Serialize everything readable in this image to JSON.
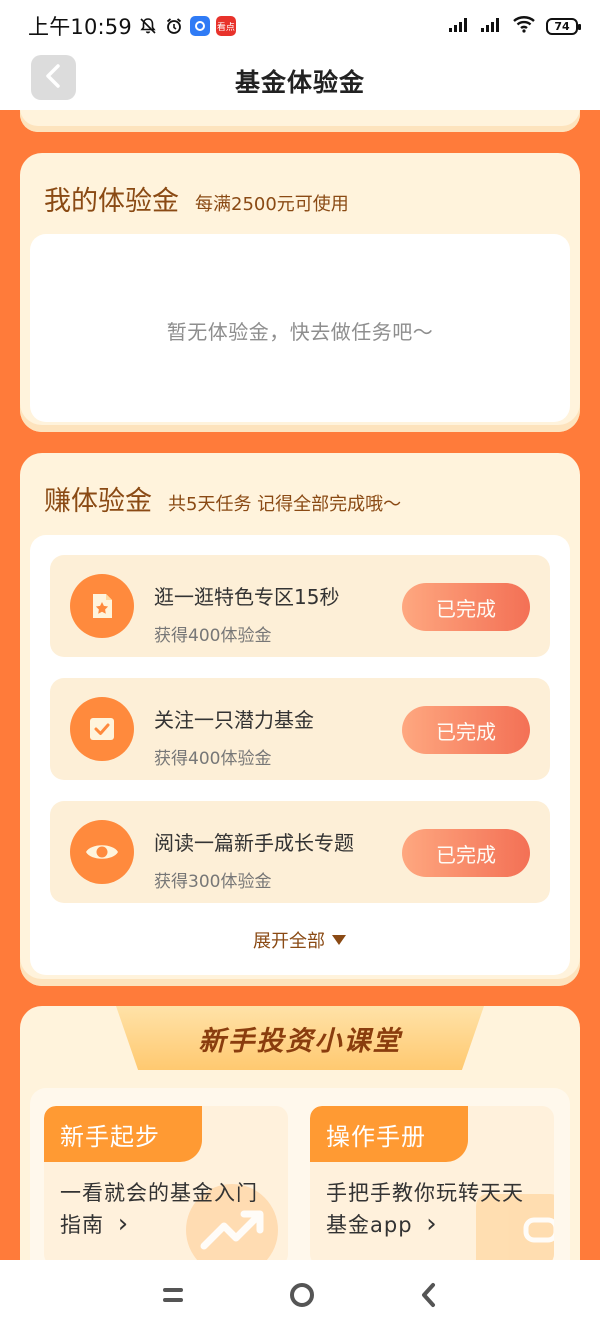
{
  "status": {
    "time": "上午10:59",
    "battery": "74",
    "app_badge": "看点"
  },
  "nav": {
    "title": "基金体验金"
  },
  "my_voucher": {
    "title": "我的体验金",
    "subtitle": "每满2500元可使用",
    "empty_text": "暂无体验金，快去做任务吧～"
  },
  "earn": {
    "title": "赚体验金",
    "subtitle": "共5天任务 记得全部完成哦～",
    "tasks": [
      {
        "name": "逛一逛特色专区15秒",
        "reward": "获得400体验金",
        "button": "已完成",
        "icon": "star-document-icon"
      },
      {
        "name": "关注一只潜力基金",
        "reward": "获得400体验金",
        "button": "已完成",
        "icon": "checkbox-icon"
      },
      {
        "name": "阅读一篇新手成长专题",
        "reward": "获得300体验金",
        "button": "已完成",
        "icon": "eye-icon"
      }
    ],
    "expand_label": "展开全部"
  },
  "classroom": {
    "banner": "新手投资小课堂",
    "courses": [
      {
        "tag": "新手起步",
        "desc": "一看就会的基金入门指南",
        "arrow": "›"
      },
      {
        "tag": "操作手册",
        "desc": "手把手教你玩转天天基金app",
        "arrow": "›"
      }
    ]
  },
  "colors": {
    "page_bg": "#ff7b3a",
    "card_bg": "#fff3dc",
    "accent_brown": "#8a4a14",
    "icon_orange": "#ff8a3d",
    "button_start": "#ff9063",
    "button_end": "#f0462a"
  }
}
